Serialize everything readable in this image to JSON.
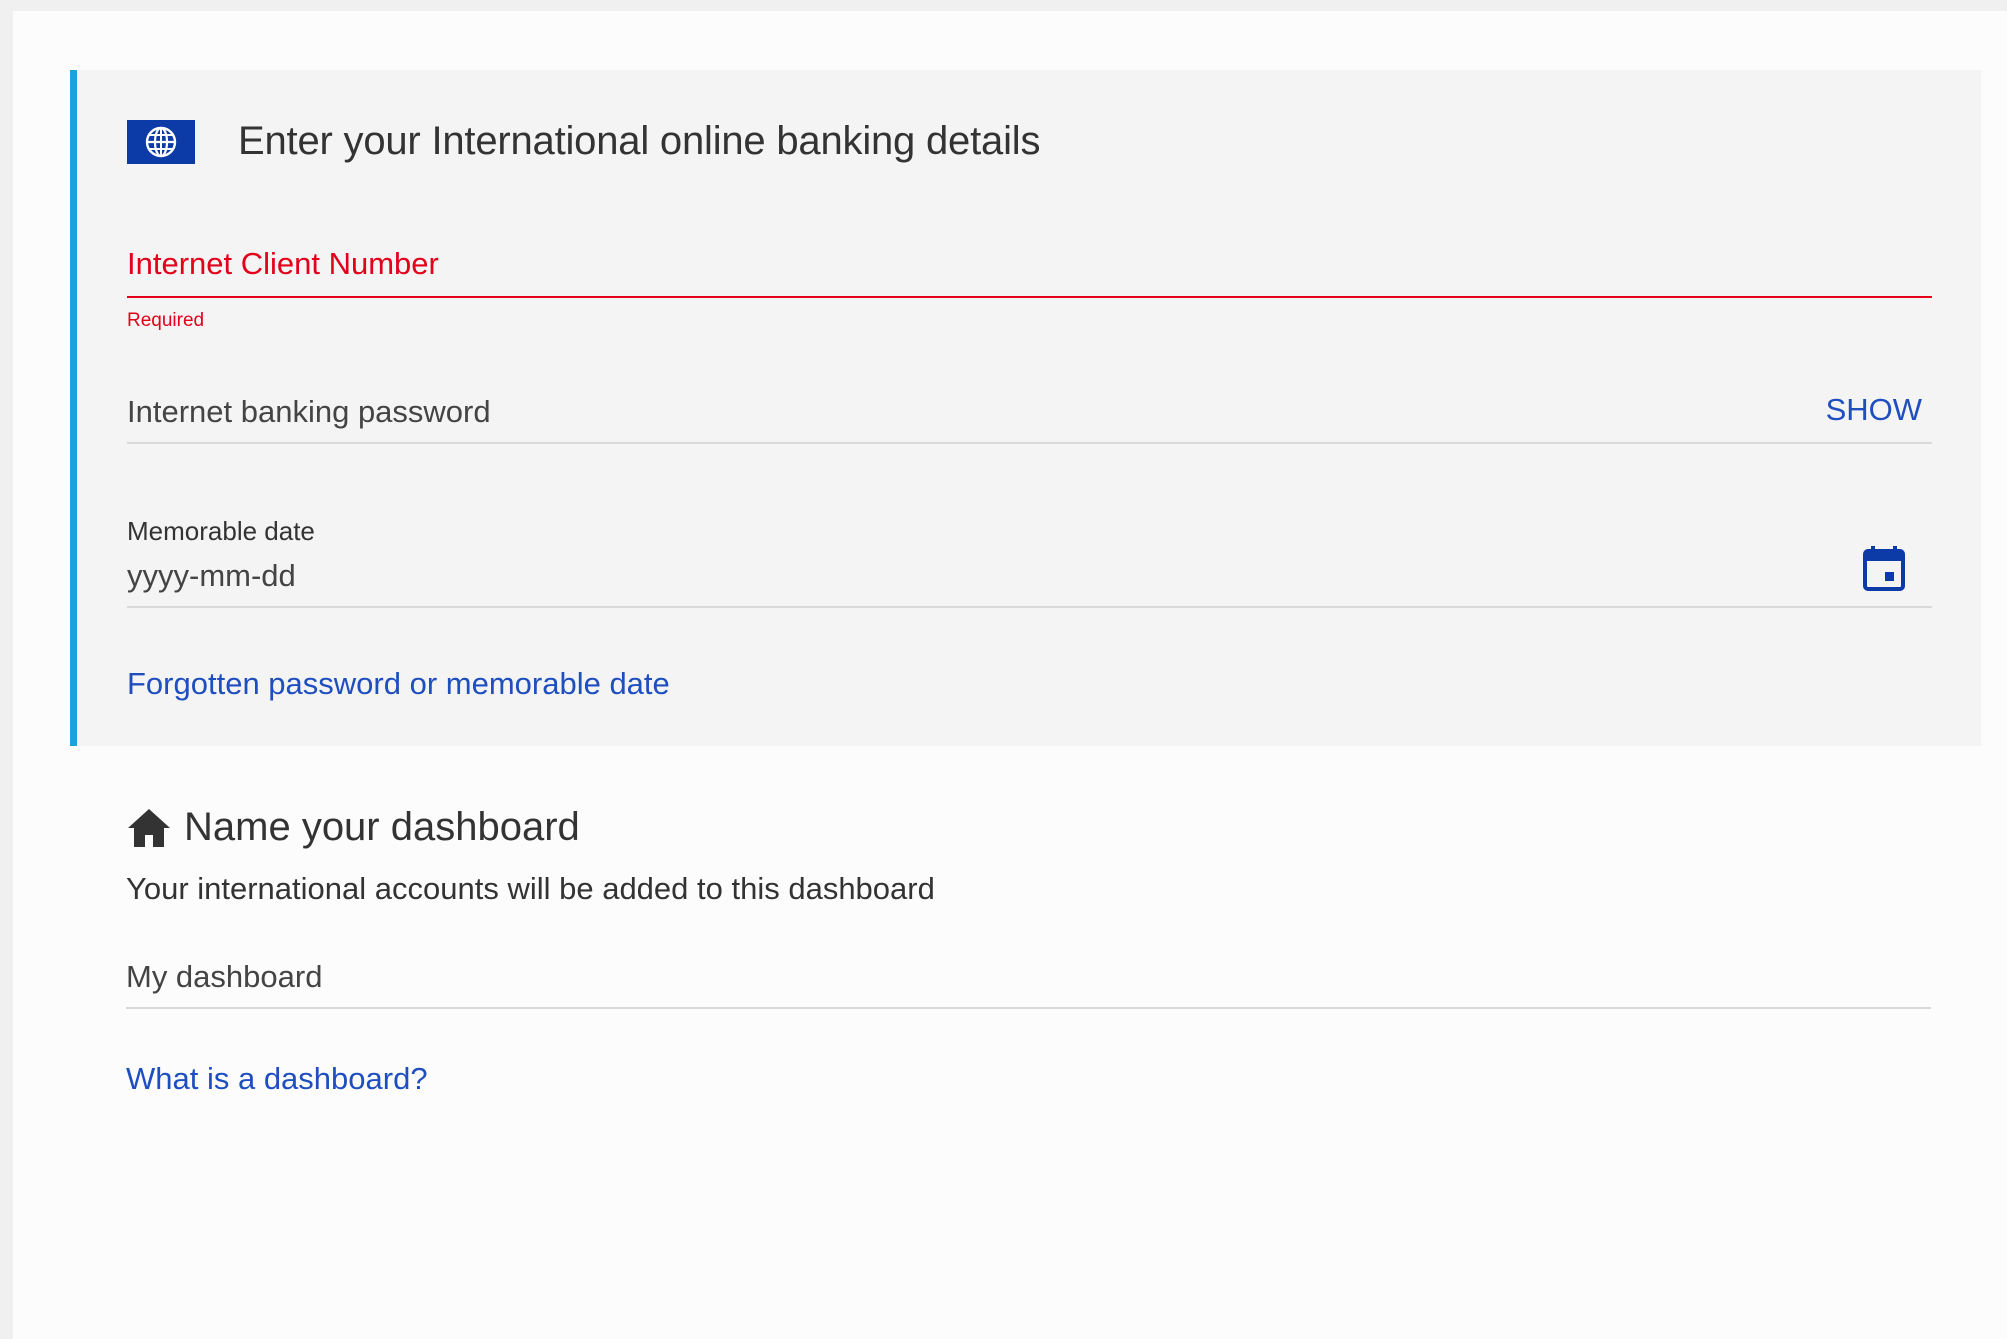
{
  "login_panel": {
    "title": "Enter your International online banking details",
    "icon": "globe-icon",
    "client_number": {
      "label": "Internet Client Number",
      "value": "",
      "error": "Required"
    },
    "password": {
      "placeholder": "Internet banking password",
      "value": "",
      "toggle_label": "SHOW"
    },
    "memorable_date": {
      "label": "Memorable date",
      "placeholder": "yyyy-mm-dd",
      "value": "",
      "icon": "calendar-icon"
    },
    "forgotten_link": "Forgotten password or memorable date"
  },
  "dashboard": {
    "icon": "home-icon",
    "title": "Name your dashboard",
    "subtitle": "Your international accounts will be added to this dashboard",
    "name_field": {
      "value": "My dashboard"
    },
    "help_link": "What is a dashboard?"
  },
  "colors": {
    "accent_bar": "#1aa3dd",
    "link": "#1f4fbf",
    "error": "#e2001a",
    "flag": "#0c3aa7",
    "panel_bg": "#f4f4f4"
  }
}
